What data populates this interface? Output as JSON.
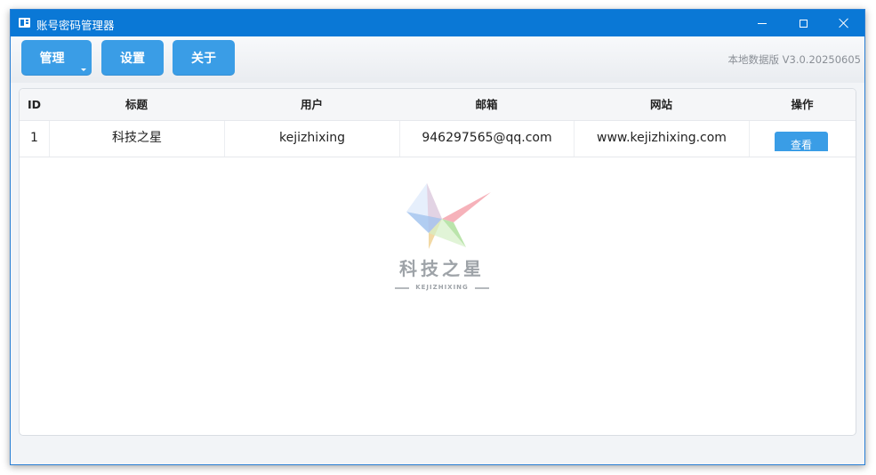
{
  "window": {
    "title": "账号密码管理器"
  },
  "toolbar": {
    "manage_label": "管理",
    "settings_label": "设置",
    "about_label": "关于",
    "version": "本地数据版 V3.0.20250605"
  },
  "table": {
    "columns": [
      "ID",
      "标题",
      "用户",
      "邮箱",
      "网站",
      "操作"
    ],
    "rows": [
      {
        "id": "1",
        "title": "科技之星",
        "user": "kejizhixing",
        "email": "946297565@qq.com",
        "site": "www.kejizhixing.com",
        "action": "查看"
      }
    ]
  },
  "watermark": {
    "text": "科技之星",
    "subtext": "KEJIZHIXING"
  },
  "colors": {
    "titlebar": "#0a78d6",
    "button": "#3a9de6",
    "version_text": "#8a8f96"
  }
}
